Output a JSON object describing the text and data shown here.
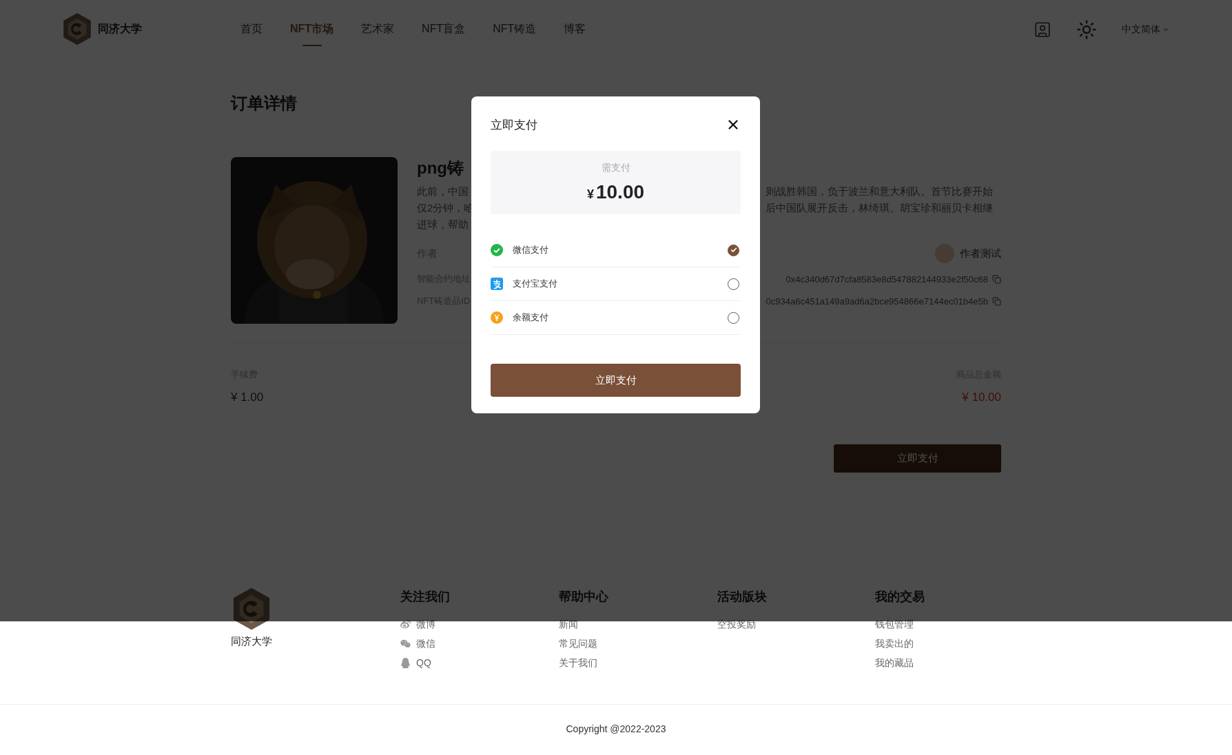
{
  "header": {
    "logo_text": "同济大学",
    "nav": [
      {
        "label": "首页",
        "selected": false
      },
      {
        "label": "NFT市场",
        "selected": true
      },
      {
        "label": "艺术家",
        "selected": false
      },
      {
        "label": "NFT盲盒",
        "selected": false
      },
      {
        "label": "NFT铸造",
        "selected": false
      },
      {
        "label": "博客",
        "selected": false
      }
    ],
    "language": "中文简体"
  },
  "page_title": "订单详情",
  "product": {
    "title": "png铸",
    "description_lines": [
      {
        "left": "此前，中国",
        "right": "则战胜韩国，负于波兰和意大利队。首节比赛开始"
      },
      {
        "left": "仅2分钟，哈",
        "right": "后中国队展开反击，林绮琪、胡宝珍和丽贝卡相继"
      },
      {
        "left": "进球，帮助"
      }
    ],
    "author": {
      "label": "作者",
      "name": "作者测试"
    },
    "contract": {
      "label": "智能合约地址",
      "value": "0x4c340d67d7cfa8583e8d547882144933e2f50c68"
    },
    "token": {
      "label": "NFT铸造品ID",
      "value": "0c934a6c451a149a9ad6a2bce954866e7144ec01b4e5b"
    }
  },
  "fees": {
    "fee_label": "手续费",
    "fee": "¥ 1.00",
    "total_label": "商品总金额",
    "total": "¥ 10.00"
  },
  "pay_button": "立即支付",
  "modal": {
    "title": "立即支付",
    "amount_label": "需支付",
    "currency": "¥",
    "amount": "10.00",
    "methods": [
      {
        "kind": "wechat",
        "label": "微信支付",
        "selected": true
      },
      {
        "kind": "alipay",
        "label": "支付宝支付",
        "selected": false
      },
      {
        "kind": "balance",
        "label": "余额支付",
        "selected": false
      }
    ],
    "button": "立即支付"
  },
  "footer": {
    "logo_text": "同济大学",
    "columns": [
      {
        "title": "关注我们",
        "links": [
          {
            "label": "微博",
            "kind": "weibo"
          },
          {
            "label": "微信",
            "kind": "wechat"
          },
          {
            "label": "QQ",
            "kind": "qq"
          }
        ]
      },
      {
        "title": "帮助中心",
        "links": [
          {
            "label": "新闻"
          },
          {
            "label": "常见问题"
          },
          {
            "label": "关于我们"
          }
        ]
      },
      {
        "title": "活动版块",
        "links": [
          {
            "label": "空投奖励"
          }
        ]
      },
      {
        "title": "我的交易",
        "links": [
          {
            "label": "钱包管理"
          },
          {
            "label": "我卖出的"
          },
          {
            "label": "我的藏品"
          }
        ]
      }
    ],
    "copyright": "Copyright @2022-2023"
  }
}
